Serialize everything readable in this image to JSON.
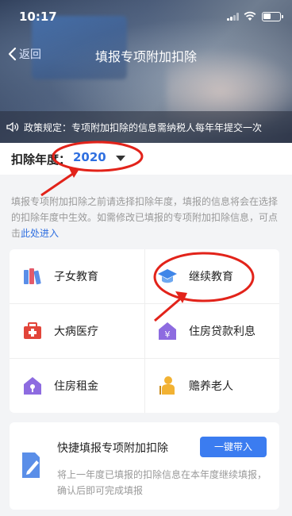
{
  "status_bar": {
    "time": "10:17"
  },
  "navbar": {
    "back_label": "返回",
    "title": "填报专项附加扣除"
  },
  "notice": {
    "text": "政策规定：专项附加扣除的信息需纳税人每年年提交一次"
  },
  "year": {
    "label": "扣除年度：",
    "value": "2020"
  },
  "description": {
    "text": "填报专项附加扣除之前请选择扣除年度，填报的信息将会在选择的扣除年度中生效。如需修改已填报的专项附加扣除信息，可点击",
    "link": "此处进入"
  },
  "categories": [
    {
      "label": "子女教育",
      "icon": "children-education-icon"
    },
    {
      "label": "继续教育",
      "icon": "graduation-cap-icon"
    },
    {
      "label": "大病医疗",
      "icon": "medical-kit-icon"
    },
    {
      "label": "住房贷款利息",
      "icon": "mortgage-icon"
    },
    {
      "label": "住房租金",
      "icon": "house-rent-icon"
    },
    {
      "label": "赡养老人",
      "icon": "elderly-icon"
    }
  ],
  "quick_fill": {
    "title": "快捷填报专项附加扣除",
    "button": "一键带入",
    "desc": "将上一年度已填报的扣除信息在本年度继续填报，确认后即可完成填报"
  },
  "colors": {
    "accent": "#2f6fe0",
    "annotation": "#e2231a",
    "button": "#3b7cf0"
  }
}
